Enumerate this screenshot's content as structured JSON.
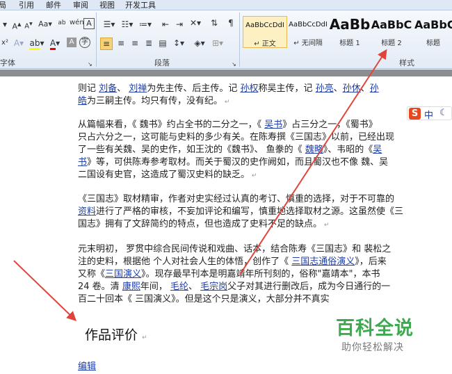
{
  "menu": {
    "items": [
      "局",
      "引用",
      "邮件",
      "审阅",
      "视图",
      "开发工具"
    ]
  },
  "ribbon": {
    "font_group_label": "字体",
    "para_group_label": "段落",
    "styles_group_label": "样式",
    "styles": [
      {
        "preview": "AaBbCcDdI",
        "name": "↵ 正文"
      },
      {
        "preview": "AaBbCcDdI",
        "name": "↵ 无间隔"
      },
      {
        "preview": "AaBb",
        "name": "标题 1"
      },
      {
        "preview": "AaBbC",
        "name": "标题 2"
      },
      {
        "preview": "AaBbC",
        "name": "标题"
      }
    ]
  },
  "doc": {
    "lines": [
      [
        [
          "则记 ",
          0
        ],
        [
          "刘备",
          1
        ],
        [
          "、 ",
          0
        ],
        [
          "刘禅",
          1
        ],
        [
          "为先主传、后主传。记 ",
          0
        ],
        [
          "孙权",
          1
        ],
        [
          "称吴主传，记 ",
          0
        ],
        [
          "孙亮",
          1
        ],
        [
          "、",
          0
        ],
        [
          "孙休",
          1
        ],
        [
          "、",
          0
        ],
        [
          "孙",
          1
        ]
      ],
      [
        [
          "皓",
          1
        ],
        [
          "为三嗣主传。均只有传，没有纪。",
          0
        ]
      ],
      [
        [
          "从篇幅来看，《 魏书》约占全书的二分之一，《 ",
          0
        ],
        [
          "吴书",
          1
        ],
        [
          "》占三分之一，《蜀书》",
          0
        ]
      ],
      [
        [
          "只占六分之一，这可能与史料的多少有关。在陈寿撰《三国志》以前，已经出现",
          0
        ]
      ],
      [
        [
          "了一些有关魏、吴的史作，如王沈的《魏书》、 鱼豢的《 ",
          0
        ],
        [
          "魏略",
          1
        ],
        [
          "》、韦昭的《",
          0
        ],
        [
          "吴",
          1
        ]
      ],
      [
        [
          "书",
          1
        ],
        [
          "》等，可供陈寿参考取材。而关于蜀汉的史作阙如，而且蜀汉也不像 魏、吴",
          0
        ]
      ],
      [
        [
          "二国设有史官，这造成了蜀汉史料的缺乏。",
          0
        ]
      ],
      [
        [
          "《三国志》取材精审，作者对史实经过认真的考订、慎重的选择，对于不可靠的",
          0
        ]
      ],
      [
        [
          "资料",
          1
        ],
        [
          "进行了严格的审核，不妄加评论和编写，慎重地选择取材之源。这虽然使《三",
          0
        ]
      ],
      [
        [
          "国志》拥有了文辞简约的特点，但也造成了史料不足的缺点。",
          0
        ]
      ],
      [
        [
          "元末明初， 罗贯中综合民间传说和戏曲、话本，结合陈寿《三国志》和 裴松之",
          0
        ]
      ],
      [
        [
          "注的史料，根据他 个人对社会人生的体悟，创作了《 ",
          0
        ],
        [
          "三国志通俗演义",
          1
        ],
        [
          "》，后来",
          0
        ]
      ],
      [
        [
          "又称《",
          0
        ],
        [
          "三国演义",
          1
        ],
        [
          "》。现存最早刊本是明嘉靖年所刊刻的，俗称\"嘉靖本\"，本书",
          0
        ]
      ],
      [
        [
          "24 卷。清 ",
          0
        ],
        [
          "康熙",
          1
        ],
        [
          "年间， ",
          0
        ],
        [
          "毛纶",
          1
        ],
        [
          "、 ",
          0
        ],
        [
          "毛宗岗",
          1
        ],
        [
          "父子对其进行删改后，成为今日通行的一",
          0
        ]
      ],
      [
        [
          "百二十回本《 三国演义》。但是这个只是演义，大部分并不真实",
          0
        ]
      ]
    ],
    "heading": "作品评价",
    "edit_link": "编辑"
  },
  "ime": {
    "logo": "S",
    "mode": "中"
  },
  "watermark": {
    "title": "百科全说",
    "subtitle": "助你轻松解决"
  },
  "arrow_color": "#e0453c"
}
